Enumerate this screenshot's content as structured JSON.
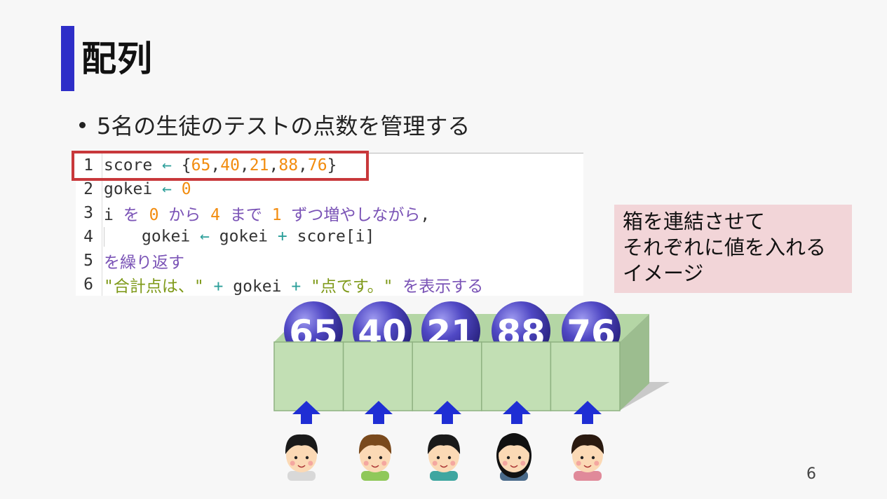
{
  "slide": {
    "title": "配列",
    "bullet": "5名の生徒のテストの点数を管理する",
    "page_number": "6"
  },
  "code": {
    "lines": [
      {
        "num": "1",
        "parts": [
          [
            "id",
            "score "
          ],
          [
            "op",
            "← "
          ],
          [
            "id",
            "{"
          ],
          [
            "num",
            "65"
          ],
          [
            "id",
            ","
          ],
          [
            "num",
            "40"
          ],
          [
            "id",
            ","
          ],
          [
            "num",
            "21"
          ],
          [
            "id",
            ","
          ],
          [
            "num",
            "88"
          ],
          [
            "id",
            ","
          ],
          [
            "num",
            "76"
          ],
          [
            "id",
            "}"
          ]
        ]
      },
      {
        "num": "2",
        "parts": [
          [
            "id",
            "gokei "
          ],
          [
            "op",
            "← "
          ],
          [
            "num",
            "0"
          ]
        ]
      },
      {
        "num": "3",
        "parts": [
          [
            "id",
            "i "
          ],
          [
            "kw",
            "を "
          ],
          [
            "num",
            "0 "
          ],
          [
            "kw",
            "から "
          ],
          [
            "num",
            "4 "
          ],
          [
            "kw",
            "まで "
          ],
          [
            "num",
            "1 "
          ],
          [
            "kw",
            "ずつ増やしながら"
          ],
          [
            "id",
            ","
          ]
        ]
      },
      {
        "num": "4",
        "parts": [
          [
            "id",
            "gokei "
          ],
          [
            "op",
            "← "
          ],
          [
            "id",
            "gokei "
          ],
          [
            "op",
            "+ "
          ],
          [
            "id",
            "score[i]"
          ]
        ]
      },
      {
        "num": "5",
        "parts": [
          [
            "kw",
            "を繰り返す"
          ]
        ]
      },
      {
        "num": "6",
        "parts": [
          [
            "str",
            "\"合計点は、\" "
          ],
          [
            "op",
            "+ "
          ],
          [
            "id",
            "gokei "
          ],
          [
            "op",
            "+ "
          ],
          [
            "str",
            "\"点です。\" "
          ],
          [
            "kw",
            "を表示する"
          ]
        ]
      }
    ]
  },
  "note": {
    "lines": [
      "箱を連結させて",
      "それぞれに値を入れる",
      "イメージ"
    ]
  },
  "array_values": [
    "65",
    "40",
    "21",
    "88",
    "76"
  ],
  "colors": {
    "accent": "#2e2ec8",
    "highlight": "#c8383b",
    "box_front": "#c2dfb4",
    "box_side": "#9cbd8f",
    "ball": "#4a44b8",
    "arrow": "#1f2ed4"
  }
}
